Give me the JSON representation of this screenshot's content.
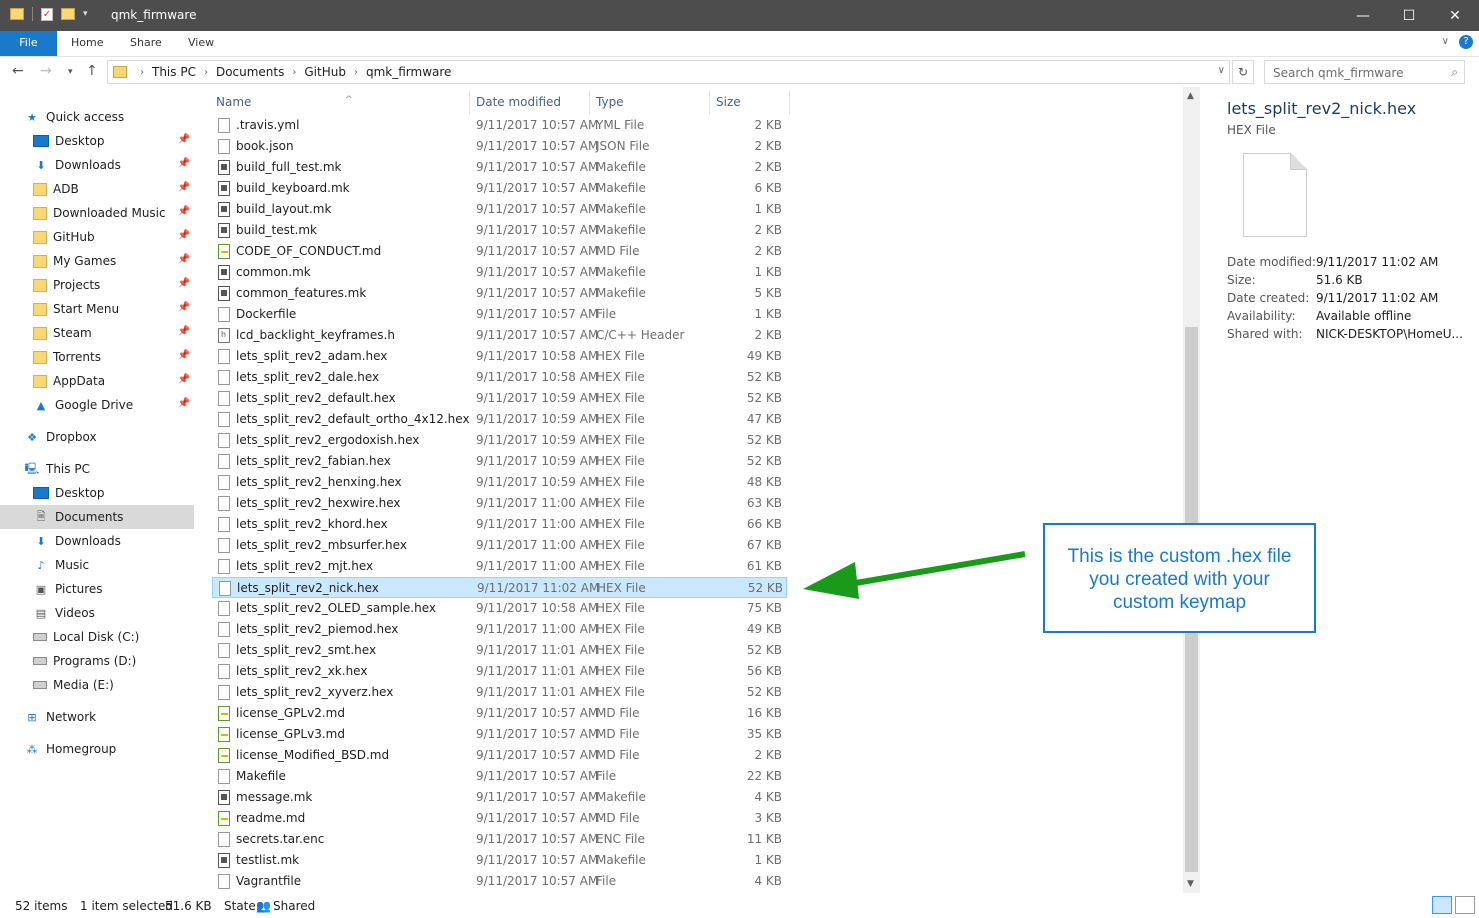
{
  "window": {
    "title": "qmk_firmware"
  },
  "ribbon": {
    "tabs": [
      "File",
      "Home",
      "Share",
      "View"
    ]
  },
  "address": {
    "crumbs": [
      "This PC",
      "Documents",
      "GitHub",
      "qmk_firmware"
    ]
  },
  "search": {
    "placeholder": "Search qmk_firmware"
  },
  "nav": [
    {
      "label": "Quick access",
      "icon": "star-icon",
      "indent": 0
    },
    {
      "label": "Desktop",
      "icon": "desktop-icon",
      "indent": 1,
      "pin": true
    },
    {
      "label": "Downloads",
      "icon": "download-icon",
      "indent": 1,
      "pin": true
    },
    {
      "label": "ADB",
      "icon": "folder-icon",
      "indent": 1,
      "pin": true
    },
    {
      "label": "Downloaded Music",
      "icon": "folder-icon",
      "indent": 1,
      "pin": true
    },
    {
      "label": "GitHub",
      "icon": "folder-icon",
      "indent": 1,
      "pin": true
    },
    {
      "label": "My Games",
      "icon": "folder-icon",
      "indent": 1,
      "pin": true
    },
    {
      "label": "Projects",
      "icon": "folder-icon",
      "indent": 1,
      "pin": true
    },
    {
      "label": "Start Menu",
      "icon": "folder-icon",
      "indent": 1,
      "pin": true
    },
    {
      "label": "Steam",
      "icon": "folder-icon",
      "indent": 1,
      "pin": true
    },
    {
      "label": "Torrents",
      "icon": "folder-icon",
      "indent": 1,
      "pin": true
    },
    {
      "label": "AppData",
      "icon": "folder-icon",
      "indent": 1,
      "pin": true
    },
    {
      "label": "Google Drive",
      "icon": "google-drive-icon",
      "indent": 1,
      "pin": true
    },
    {
      "label": "Dropbox",
      "icon": "dropbox-icon",
      "indent": 0
    },
    {
      "label": "This PC",
      "icon": "computer-icon",
      "indent": 0
    },
    {
      "label": "Desktop",
      "icon": "desktop-icon",
      "indent": 1
    },
    {
      "label": "Documents",
      "icon": "documents-icon",
      "indent": 1,
      "selected": true
    },
    {
      "label": "Downloads",
      "icon": "download-icon",
      "indent": 1
    },
    {
      "label": "Music",
      "icon": "music-icon",
      "indent": 1
    },
    {
      "label": "Pictures",
      "icon": "pictures-icon",
      "indent": 1
    },
    {
      "label": "Videos",
      "icon": "videos-icon",
      "indent": 1
    },
    {
      "label": "Local Disk (C:)",
      "icon": "drive-icon",
      "indent": 1
    },
    {
      "label": "Programs (D:)",
      "icon": "drive-icon",
      "indent": 1
    },
    {
      "label": "Media (E:)",
      "icon": "drive-icon",
      "indent": 1
    },
    {
      "label": "Network",
      "icon": "network-icon",
      "indent": 0
    },
    {
      "label": "Homegroup",
      "icon": "homegroup-icon",
      "indent": 0
    }
  ],
  "columns": {
    "name": "Name",
    "date": "Date modified",
    "type": "Type",
    "size": "Size"
  },
  "files": [
    {
      "name": ".travis.yml",
      "date": "9/11/2017 10:57 AM",
      "type": "YML File",
      "size": "2 KB",
      "icon": "file"
    },
    {
      "name": "book.json",
      "date": "9/11/2017 10:57 AM",
      "type": "JSON File",
      "size": "2 KB",
      "icon": "file"
    },
    {
      "name": "build_full_test.mk",
      "date": "9/11/2017 10:57 AM",
      "type": "Makefile",
      "size": "2 KB",
      "icon": "mk"
    },
    {
      "name": "build_keyboard.mk",
      "date": "9/11/2017 10:57 AM",
      "type": "Makefile",
      "size": "6 KB",
      "icon": "mk"
    },
    {
      "name": "build_layout.mk",
      "date": "9/11/2017 10:57 AM",
      "type": "Makefile",
      "size": "1 KB",
      "icon": "mk"
    },
    {
      "name": "build_test.mk",
      "date": "9/11/2017 10:57 AM",
      "type": "Makefile",
      "size": "2 KB",
      "icon": "mk"
    },
    {
      "name": "CODE_OF_CONDUCT.md",
      "date": "9/11/2017 10:57 AM",
      "type": "MD File",
      "size": "2 KB",
      "icon": "md"
    },
    {
      "name": "common.mk",
      "date": "9/11/2017 10:57 AM",
      "type": "Makefile",
      "size": "1 KB",
      "icon": "mk"
    },
    {
      "name": "common_features.mk",
      "date": "9/11/2017 10:57 AM",
      "type": "Makefile",
      "size": "5 KB",
      "icon": "mk"
    },
    {
      "name": "Dockerfile",
      "date": "9/11/2017 10:57 AM",
      "type": "File",
      "size": "1 KB",
      "icon": "file"
    },
    {
      "name": "lcd_backlight_keyframes.h",
      "date": "9/11/2017 10:57 AM",
      "type": "C/C++ Header",
      "size": "2 KB",
      "icon": "h"
    },
    {
      "name": "lets_split_rev2_adam.hex",
      "date": "9/11/2017 10:58 AM",
      "type": "HEX File",
      "size": "49 KB",
      "icon": "file"
    },
    {
      "name": "lets_split_rev2_dale.hex",
      "date": "9/11/2017 10:58 AM",
      "type": "HEX File",
      "size": "52 KB",
      "icon": "file"
    },
    {
      "name": "lets_split_rev2_default.hex",
      "date": "9/11/2017 10:59 AM",
      "type": "HEX File",
      "size": "52 KB",
      "icon": "file"
    },
    {
      "name": "lets_split_rev2_default_ortho_4x12.hex",
      "date": "9/11/2017 10:59 AM",
      "type": "HEX File",
      "size": "47 KB",
      "icon": "file"
    },
    {
      "name": "lets_split_rev2_ergodoxish.hex",
      "date": "9/11/2017 10:59 AM",
      "type": "HEX File",
      "size": "52 KB",
      "icon": "file"
    },
    {
      "name": "lets_split_rev2_fabian.hex",
      "date": "9/11/2017 10:59 AM",
      "type": "HEX File",
      "size": "52 KB",
      "icon": "file"
    },
    {
      "name": "lets_split_rev2_henxing.hex",
      "date": "9/11/2017 10:59 AM",
      "type": "HEX File",
      "size": "48 KB",
      "icon": "file"
    },
    {
      "name": "lets_split_rev2_hexwire.hex",
      "date": "9/11/2017 11:00 AM",
      "type": "HEX File",
      "size": "63 KB",
      "icon": "file"
    },
    {
      "name": "lets_split_rev2_khord.hex",
      "date": "9/11/2017 11:00 AM",
      "type": "HEX File",
      "size": "66 KB",
      "icon": "file"
    },
    {
      "name": "lets_split_rev2_mbsurfer.hex",
      "date": "9/11/2017 11:00 AM",
      "type": "HEX File",
      "size": "67 KB",
      "icon": "file"
    },
    {
      "name": "lets_split_rev2_mjt.hex",
      "date": "9/11/2017 11:00 AM",
      "type": "HEX File",
      "size": "61 KB",
      "icon": "file"
    },
    {
      "name": "lets_split_rev2_nick.hex",
      "date": "9/11/2017 11:02 AM",
      "type": "HEX File",
      "size": "52 KB",
      "icon": "file",
      "selected": true
    },
    {
      "name": "lets_split_rev2_OLED_sample.hex",
      "date": "9/11/2017 10:58 AM",
      "type": "HEX File",
      "size": "75 KB",
      "icon": "file"
    },
    {
      "name": "lets_split_rev2_piemod.hex",
      "date": "9/11/2017 11:00 AM",
      "type": "HEX File",
      "size": "49 KB",
      "icon": "file"
    },
    {
      "name": "lets_split_rev2_smt.hex",
      "date": "9/11/2017 11:01 AM",
      "type": "HEX File",
      "size": "52 KB",
      "icon": "file"
    },
    {
      "name": "lets_split_rev2_xk.hex",
      "date": "9/11/2017 11:01 AM",
      "type": "HEX File",
      "size": "56 KB",
      "icon": "file"
    },
    {
      "name": "lets_split_rev2_xyverz.hex",
      "date": "9/11/2017 11:01 AM",
      "type": "HEX File",
      "size": "52 KB",
      "icon": "file"
    },
    {
      "name": "license_GPLv2.md",
      "date": "9/11/2017 10:57 AM",
      "type": "MD File",
      "size": "16 KB",
      "icon": "md"
    },
    {
      "name": "license_GPLv3.md",
      "date": "9/11/2017 10:57 AM",
      "type": "MD File",
      "size": "35 KB",
      "icon": "md"
    },
    {
      "name": "license_Modified_BSD.md",
      "date": "9/11/2017 10:57 AM",
      "type": "MD File",
      "size": "2 KB",
      "icon": "md"
    },
    {
      "name": "Makefile",
      "date": "9/11/2017 10:57 AM",
      "type": "File",
      "size": "22 KB",
      "icon": "file"
    },
    {
      "name": "message.mk",
      "date": "9/11/2017 10:57 AM",
      "type": "Makefile",
      "size": "4 KB",
      "icon": "mk"
    },
    {
      "name": "readme.md",
      "date": "9/11/2017 10:57 AM",
      "type": "MD File",
      "size": "3 KB",
      "icon": "md"
    },
    {
      "name": "secrets.tar.enc",
      "date": "9/11/2017 10:57 AM",
      "type": "ENC File",
      "size": "11 KB",
      "icon": "file"
    },
    {
      "name": "testlist.mk",
      "date": "9/11/2017 10:57 AM",
      "type": "Makefile",
      "size": "1 KB",
      "icon": "mk"
    },
    {
      "name": "Vagrantfile",
      "date": "9/11/2017 10:57 AM",
      "type": "File",
      "size": "4 KB",
      "icon": "file"
    }
  ],
  "details": {
    "title": "lets_split_rev2_nick.hex",
    "type": "HEX File",
    "props": [
      {
        "label": "Date modified:",
        "value": "9/11/2017 11:02 AM"
      },
      {
        "label": "Size:",
        "value": "51.6 KB"
      },
      {
        "label": "Date created:",
        "value": "9/11/2017 11:02 AM"
      },
      {
        "label": "Availability:",
        "value": "Available offline"
      },
      {
        "label": "Shared with:",
        "value": "NICK-DESKTOP\\HomeU..."
      }
    ]
  },
  "annotation": {
    "lines": [
      "This is the custom .hex file",
      "you created with your",
      "custom keymap"
    ],
    "arrow_color": "#1a9a1a",
    "box_color": "#1979ca"
  },
  "status": {
    "items": "52 items",
    "selected": "1 item selected",
    "size": "51.6 KB",
    "state_label": "State:",
    "state_value": "Shared"
  }
}
